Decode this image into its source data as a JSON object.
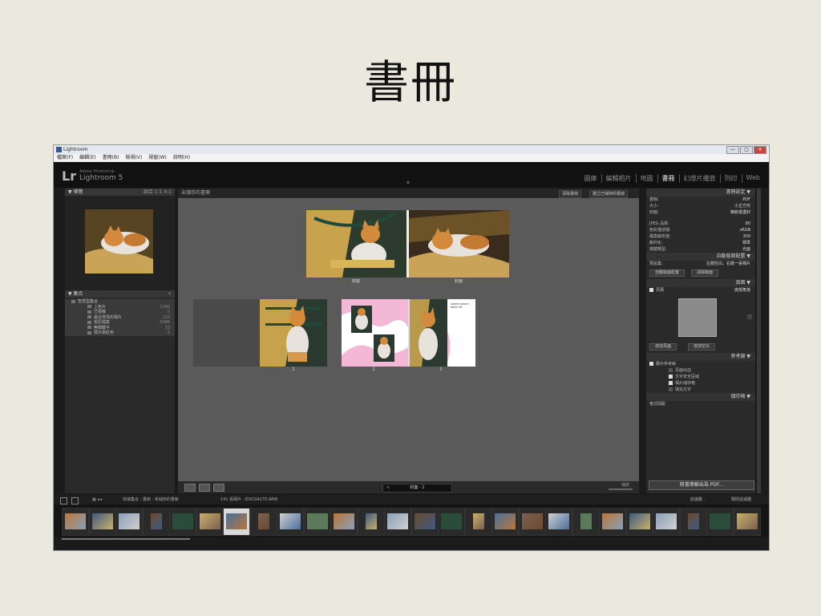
{
  "slide": {
    "title": "書冊"
  },
  "window": {
    "title": "Lightroom",
    "controls": [
      "—",
      "▢",
      "✕"
    ]
  },
  "menu": [
    "檔案(F)",
    "編輯(E)",
    "書冊(B)",
    "檢視(V)",
    "視窗(W)",
    "說明(H)"
  ],
  "identity": {
    "logo": "Lr",
    "small": "Adobe Photoshop",
    "name": "Lightroom 5"
  },
  "modules": [
    "圖庫",
    "編輯相片",
    "地圖",
    "書冊",
    "幻燈片播放",
    "列印",
    "Web"
  ],
  "left_panel": {
    "navigator_title": "導覽",
    "navigator_controls": "調合  1:1  4:1",
    "collections_title": "集合",
    "collections": [
      {
        "label": "智慧型集合",
        "count": "",
        "level": "top"
      },
      {
        "label": "上色片",
        "count": "1340",
        "level": "item"
      },
      {
        "label": "已標籤",
        "count": "0",
        "level": "item"
      },
      {
        "label": "最近修改的相片",
        "count": "110",
        "level": "item"
      },
      {
        "label": "視訊檔案",
        "count": "5086",
        "level": "item"
      },
      {
        "label": "無關鍵字",
        "count": "10",
        "level": "item"
      },
      {
        "label": "標示為紅色",
        "count": "5",
        "level": "item"
      }
    ]
  },
  "main": {
    "breadcrumb": "未儲存的書冊",
    "clear_button": "清除書冊",
    "create_button": "建立已儲存的書冊",
    "cover_labels": [
      "封底",
      "封面"
    ],
    "page_numbers": [
      "1",
      "2",
      "3"
    ],
    "page_text": "Lorem ipsum dolor sit"
  },
  "bottom_toolbar": {
    "page_label": "封面 - 1",
    "zoom_label": "縮放"
  },
  "right_panel": {
    "book_settings": "書冊設定",
    "rows": [
      {
        "label": "書冊:",
        "value": "PDF"
      },
      {
        "label": "大小:",
        "value": "小正方形"
      },
      {
        "label": "封面:",
        "value": "精裝書護封"
      }
    ],
    "quality_rows": [
      {
        "label": "JPEG 品質:",
        "value": "80"
      },
      {
        "label": "色彩描述檔:",
        "value": "sRGB"
      },
      {
        "label": "檔案解析度:",
        "value": "300"
      },
      {
        "label": "銳利化:",
        "value": "標準"
      },
      {
        "label": "媒體類型:",
        "value": "光面"
      }
    ],
    "autolayout": "自動版面配置",
    "preset_label": "預設集:",
    "preset_value": "左側空白，右側一張相片",
    "autolayout_btn": "自動版面配置",
    "clear_layout_btn": "清除版面",
    "page_section": "頁面",
    "page_checkbox": "頁碼",
    "page_position": "底部角落",
    "add_page_btn": "增加頁面",
    "add_blank_btn": "增加空白",
    "guides_section": "參考線",
    "guides_show": "顯示參考線",
    "guides_items": [
      {
        "label": "頁面出血",
        "on": false
      },
      {
        "label": "文字安全區域",
        "on": true
      },
      {
        "label": "相片儲存格",
        "on": true
      },
      {
        "label": "填充文字",
        "on": false
      }
    ],
    "cells_section": "儲存格",
    "cells_value": "格式間距",
    "send_button": "將書冊輸出為 PDF..."
  },
  "filmstrip_bar": {
    "info": "快速集合 : 書冊 : 未儲存的書冊",
    "count": "141 張相片",
    "file": "/DSC04270.ARW",
    "filter_label": "過濾器 :",
    "filter_value": "關閉過濾器"
  },
  "colors": {
    "background": "#ebe8dd",
    "app_dark": "#1b1b1b",
    "canvas": "#5a5a5a",
    "pink_art": "#f2b8d6"
  }
}
